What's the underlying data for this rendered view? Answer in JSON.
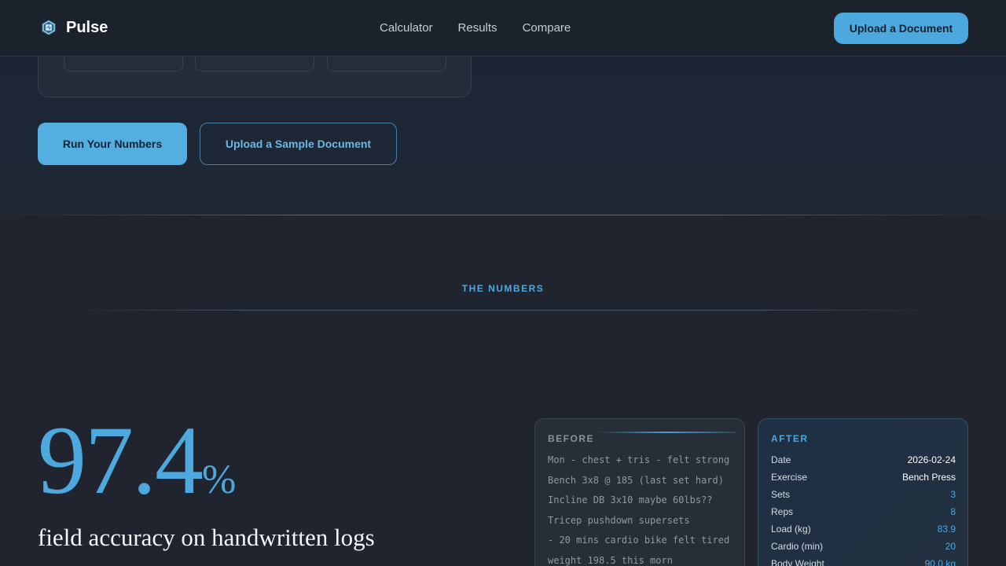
{
  "header": {
    "brand": "Pulse",
    "nav": [
      "Calculator",
      "Results",
      "Compare"
    ],
    "cta": "Upload a Document"
  },
  "hero": {
    "primary_button": "Run Your Numbers",
    "secondary_button": "Upload a Sample Document"
  },
  "numbers": {
    "section_label": "THE NUMBERS",
    "stat_value": "97.4",
    "stat_unit": "%",
    "stat_caption": "field accuracy on handwritten logs"
  },
  "before": {
    "title": "BEFORE",
    "lines": [
      "Mon - chest + tris - felt strong",
      "Bench 3x8 @ 185 (last set hard)",
      "Incline DB 3x10 maybe 60lbs??",
      "Tricep pushdown supersets",
      "- 20 mins cardio bike felt tired",
      "weight 198.5 this morn"
    ]
  },
  "after": {
    "title": "AFTER",
    "rows": [
      {
        "label": "Date",
        "value": "2026-02-24",
        "kind": "text"
      },
      {
        "label": "Exercise",
        "value": "Bench Press",
        "kind": "text"
      },
      {
        "label": "Sets",
        "value": "3",
        "kind": "num"
      },
      {
        "label": "Reps",
        "value": "8",
        "kind": "num"
      },
      {
        "label": "Load (kg)",
        "value": "83.9",
        "kind": "num"
      },
      {
        "label": "Cardio (min)",
        "value": "20",
        "kind": "num"
      },
      {
        "label": "Body Weight",
        "value": "90.0 kg",
        "kind": "num"
      }
    ]
  },
  "colors": {
    "accent": "#4da9dd",
    "background": "#1f242e",
    "header": "#1c222c"
  }
}
